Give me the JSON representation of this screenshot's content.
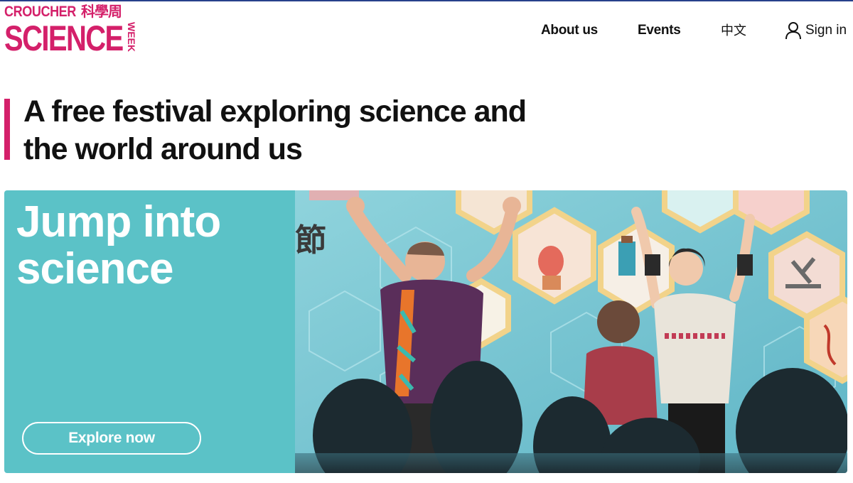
{
  "logo": {
    "line1": "CROUCHER",
    "cjk": "科學周",
    "line2": "SCIENCE",
    "side": "WEEK",
    "color": "#d4206a"
  },
  "nav": {
    "about": "About us",
    "events": "Events",
    "language": "中文",
    "signin": "Sign in",
    "signin_icon": "user-icon"
  },
  "headline": {
    "line1": "A free festival exploring science and",
    "line2": "the world around us",
    "accent_color": "#d4206a"
  },
  "hero": {
    "title_line1": "Jump into",
    "title_line2": "science",
    "button_label": "Explore now",
    "panel_color": "#5bc2c7",
    "photo_background_text": "節",
    "photo_description_icon": "stage-performance-photo"
  },
  "colors": {
    "brand_pink": "#d4206a",
    "teal": "#5bc2c7",
    "top_rule": "#27408b"
  }
}
